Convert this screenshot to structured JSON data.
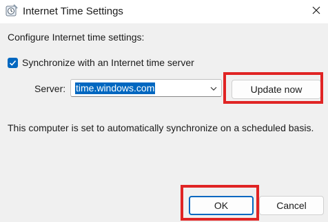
{
  "window": {
    "title": "Internet Time Settings",
    "title_icon": "clock-settings-icon",
    "close_icon": "close-icon"
  },
  "main": {
    "intro": "Configure Internet time settings:",
    "sync_checkbox": {
      "label": "Synchronize with an Internet time server",
      "checked": true
    },
    "server": {
      "label": "Server:",
      "value": "time.windows.com",
      "dropdown_icon": "chevron-down-icon"
    },
    "update_button": "Update now",
    "status_text": "This computer is set to automatically synchronize on a scheduled basis."
  },
  "footer": {
    "ok_label": "OK",
    "cancel_label": "Cancel"
  },
  "colors": {
    "accent": "#0067c0",
    "highlight_box": "#e02424",
    "background": "#f0f0f0"
  }
}
